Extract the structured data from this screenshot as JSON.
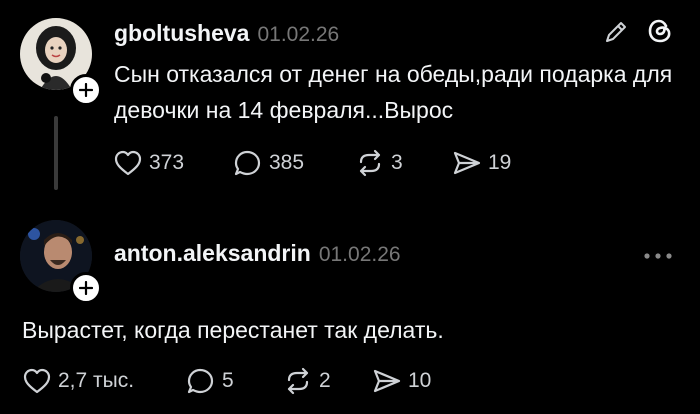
{
  "posts": [
    {
      "username": "gboltusheva",
      "date": "01.02.26",
      "text": "Сын отказался от денег на обеды,ради подарка для девочки на 14 февраля...Вырос",
      "likes": "373",
      "replies": "385",
      "reposts": "3",
      "shares": "19"
    },
    {
      "username": "anton.aleksandrin",
      "date": "01.02.26",
      "text": "Вырастет, когда перестанет так делать.",
      "likes": "2,7 тыс.",
      "replies": "5",
      "reposts": "2",
      "shares": "10"
    }
  ],
  "icons": {
    "edit": "pencil-icon",
    "app": "threads-logo-icon",
    "more": "more-dots-icon"
  },
  "colors": {
    "background": "#000000",
    "text": "#f3f5f7",
    "muted": "#777777"
  }
}
